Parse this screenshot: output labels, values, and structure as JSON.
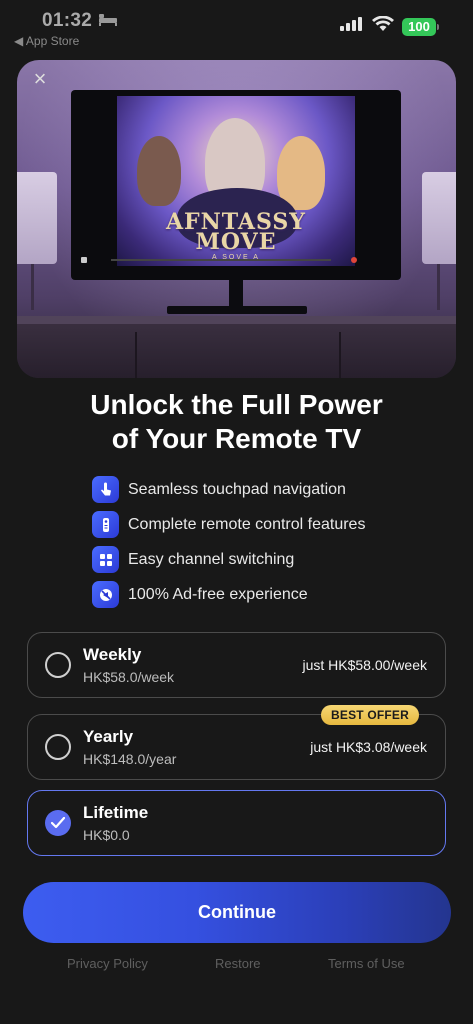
{
  "status_bar": {
    "time": "01:32",
    "back_label": "◀ App Store",
    "battery": "100"
  },
  "hero": {
    "movie_title_line1": "AFNTASSY",
    "movie_title_line2": "MOVE",
    "movie_subtitle": "A SOVE A"
  },
  "headline": {
    "line1": "Unlock the Full Power",
    "line2": "of Your Remote TV"
  },
  "features": [
    {
      "icon": "touchpad-icon",
      "text": "Seamless touchpad navigation"
    },
    {
      "icon": "remote-icon",
      "text": "Complete remote control features"
    },
    {
      "icon": "grid-icon",
      "text": "Easy channel switching"
    },
    {
      "icon": "no-ads-icon",
      "text": "100% Ad-free experience"
    }
  ],
  "plans": [
    {
      "name": "Weekly",
      "sub": "HK$58.0/week",
      "right": "just HK$58.00/week",
      "selected": false
    },
    {
      "name": "Yearly",
      "sub": "HK$148.0/year",
      "right": "just HK$3.08/week",
      "badge": "BEST OFFER",
      "selected": false
    },
    {
      "name": "Lifetime",
      "sub": "HK$0.0",
      "right": "",
      "selected": true
    }
  ],
  "continue_label": "Continue",
  "footer": {
    "privacy": "Privacy Policy",
    "restore": "Restore",
    "terms": "Terms of Use"
  },
  "colors": {
    "background": "#181818",
    "accent": "#3d5df0",
    "selected_border": "#6478f0",
    "badge": "#f6d774",
    "battery": "#34c759"
  }
}
